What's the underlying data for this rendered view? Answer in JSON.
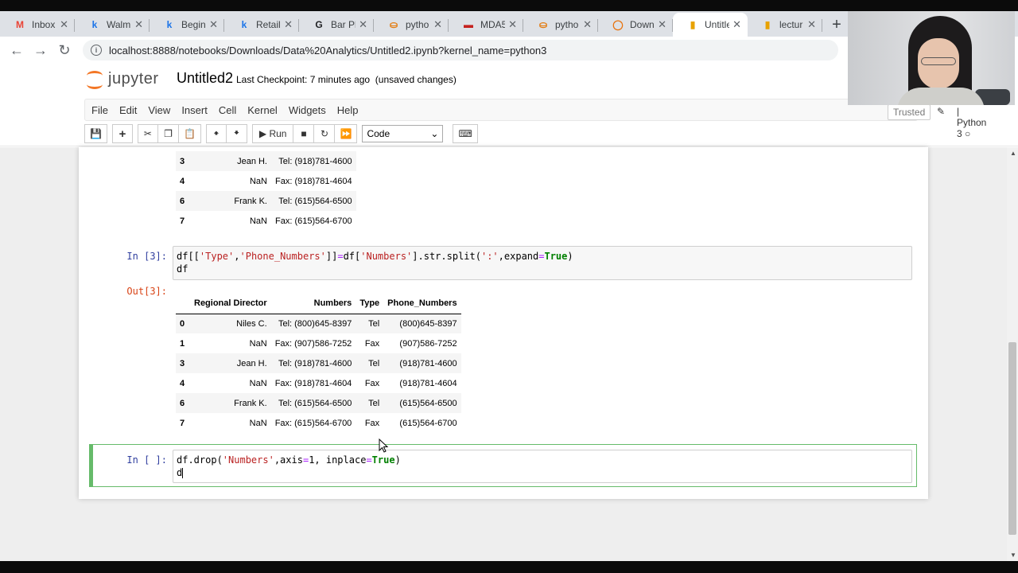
{
  "browser": {
    "tabs": [
      {
        "icon": "M",
        "icon_color": "#ea4335",
        "title": "Inbox"
      },
      {
        "icon": "k",
        "icon_color": "#1a73e8",
        "title": "Walm"
      },
      {
        "icon": "k",
        "icon_color": "#1a73e8",
        "title": "Beginn"
      },
      {
        "icon": "k",
        "icon_color": "#1a73e8",
        "title": "Retail"
      },
      {
        "icon": "G",
        "icon_color": "#202124",
        "title": "Bar Plo"
      },
      {
        "icon": "⛀",
        "icon_color": "#e37400",
        "title": "pytho"
      },
      {
        "icon": "▬",
        "icon_color": "#c5221f",
        "title": "MDA5"
      },
      {
        "icon": "⛀",
        "icon_color": "#e37400",
        "title": "pytho"
      },
      {
        "icon": "◯",
        "icon_color": "#e8710a",
        "title": "Downl"
      },
      {
        "icon": "▮",
        "icon_color": "#e8a200",
        "title": "Untitle"
      },
      {
        "icon": "▮",
        "icon_color": "#e8a200",
        "title": "lectur"
      }
    ],
    "active_tab_index": 9,
    "new_tab_label": "+",
    "url": "localhost:8888/notebooks/Downloads/Data%20Analytics/Untitled2.ipynb?kernel_name=python3"
  },
  "jupyter": {
    "logo_text": "jupyter",
    "notebook_name": "Untitled2",
    "checkpoint": "Last Checkpoint: 7 minutes ago",
    "save_status": "(unsaved changes)",
    "menu": [
      "File",
      "Edit",
      "View",
      "Insert",
      "Cell",
      "Kernel",
      "Widgets",
      "Help"
    ],
    "trusted_label": "Trusted",
    "kernel_label": "Python 3",
    "run_label": "Run",
    "cell_type": "Code"
  },
  "cells": {
    "partial_output_rows": [
      {
        "idx": "3",
        "director": "Jean H.",
        "numbers": "Tel: (918)781-4600"
      },
      {
        "idx": "4",
        "director": "NaN",
        "numbers": "Fax: (918)781-4604"
      },
      {
        "idx": "6",
        "director": "Frank K.",
        "numbers": "Tel: (615)564-6500"
      },
      {
        "idx": "7",
        "director": "NaN",
        "numbers": "Fax: (615)564-6700"
      }
    ],
    "cell3_prompt": "In [3]:",
    "cell3_out_prompt": "Out[3]:",
    "cell3_columns": [
      "Regional Director",
      "Numbers",
      "Type",
      "Phone_Numbers"
    ],
    "cell3_rows": [
      {
        "idx": "0",
        "director": "Niles C.",
        "numbers": "Tel: (800)645-8397",
        "type": "Tel",
        "phone": "(800)645-8397"
      },
      {
        "idx": "1",
        "director": "NaN",
        "numbers": "Fax: (907)586-7252",
        "type": "Fax",
        "phone": "(907)586-7252"
      },
      {
        "idx": "3",
        "director": "Jean H.",
        "numbers": "Tel: (918)781-4600",
        "type": "Tel",
        "phone": "(918)781-4600"
      },
      {
        "idx": "4",
        "director": "NaN",
        "numbers": "Fax: (918)781-4604",
        "type": "Fax",
        "phone": "(918)781-4604"
      },
      {
        "idx": "6",
        "director": "Frank K.",
        "numbers": "Tel: (615)564-6500",
        "type": "Tel",
        "phone": "(615)564-6500"
      },
      {
        "idx": "7",
        "director": "NaN",
        "numbers": "Fax: (615)564-6700",
        "type": "Fax",
        "phone": "(615)564-6700"
      }
    ],
    "active_prompt": "In [ ]:"
  }
}
